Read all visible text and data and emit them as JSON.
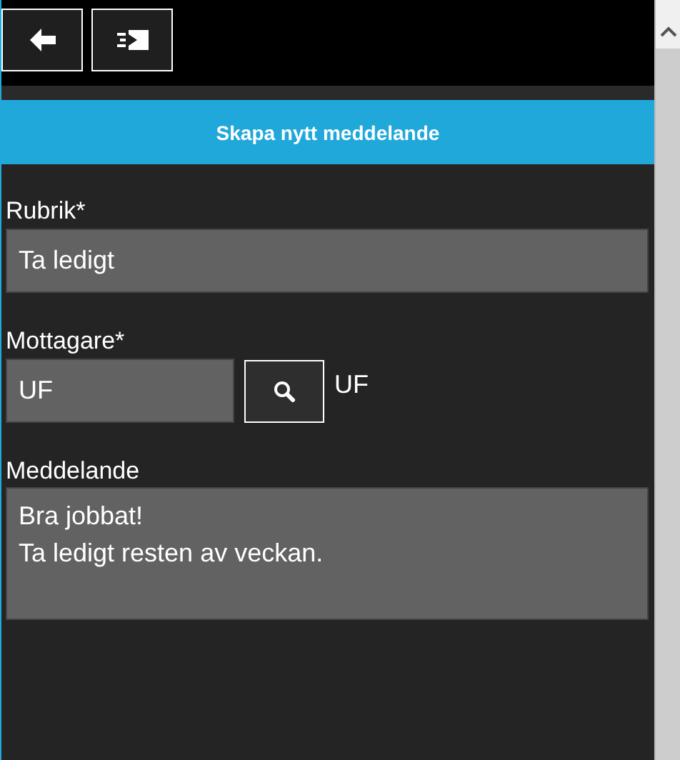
{
  "toolbar": {
    "buttons": [
      {
        "kind": "back"
      },
      {
        "kind": "send"
      }
    ]
  },
  "header": {
    "title": "Skapa nytt meddelande"
  },
  "form": {
    "subject": {
      "label": "Rubrik*",
      "value": "Ta ledigt"
    },
    "recipient": {
      "label": "Mottagare*",
      "value": "UF",
      "resolved": "UF"
    },
    "message": {
      "label": "Meddelande",
      "value": "Bra jobbat!\nTa ledigt resten av veckan."
    }
  }
}
